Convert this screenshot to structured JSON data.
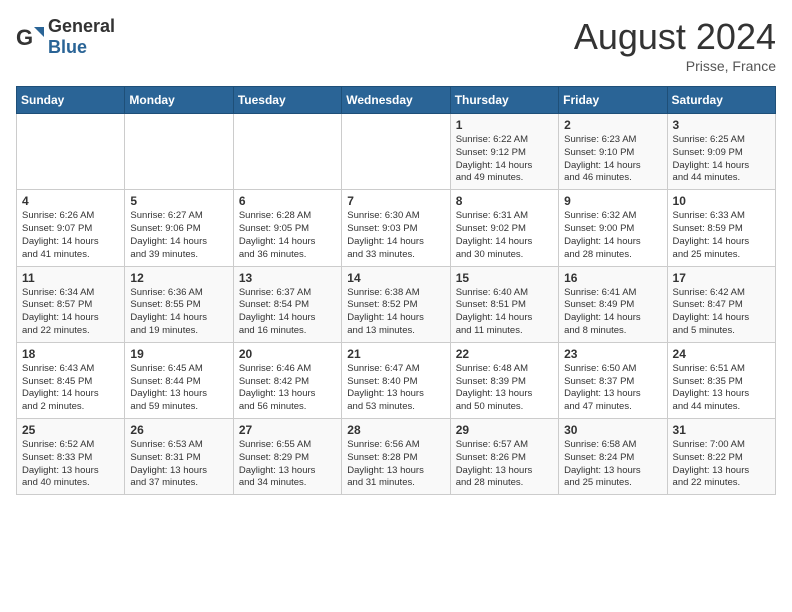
{
  "header": {
    "logo_general": "General",
    "logo_blue": "Blue",
    "month_year": "August 2024",
    "location": "Prisse, France"
  },
  "weekdays": [
    "Sunday",
    "Monday",
    "Tuesday",
    "Wednesday",
    "Thursday",
    "Friday",
    "Saturday"
  ],
  "weeks": [
    [
      {
        "day": "",
        "info": ""
      },
      {
        "day": "",
        "info": ""
      },
      {
        "day": "",
        "info": ""
      },
      {
        "day": "",
        "info": ""
      },
      {
        "day": "1",
        "info": "Sunrise: 6:22 AM\nSunset: 9:12 PM\nDaylight: 14 hours\nand 49 minutes."
      },
      {
        "day": "2",
        "info": "Sunrise: 6:23 AM\nSunset: 9:10 PM\nDaylight: 14 hours\nand 46 minutes."
      },
      {
        "day": "3",
        "info": "Sunrise: 6:25 AM\nSunset: 9:09 PM\nDaylight: 14 hours\nand 44 minutes."
      }
    ],
    [
      {
        "day": "4",
        "info": "Sunrise: 6:26 AM\nSunset: 9:07 PM\nDaylight: 14 hours\nand 41 minutes."
      },
      {
        "day": "5",
        "info": "Sunrise: 6:27 AM\nSunset: 9:06 PM\nDaylight: 14 hours\nand 39 minutes."
      },
      {
        "day": "6",
        "info": "Sunrise: 6:28 AM\nSunset: 9:05 PM\nDaylight: 14 hours\nand 36 minutes."
      },
      {
        "day": "7",
        "info": "Sunrise: 6:30 AM\nSunset: 9:03 PM\nDaylight: 14 hours\nand 33 minutes."
      },
      {
        "day": "8",
        "info": "Sunrise: 6:31 AM\nSunset: 9:02 PM\nDaylight: 14 hours\nand 30 minutes."
      },
      {
        "day": "9",
        "info": "Sunrise: 6:32 AM\nSunset: 9:00 PM\nDaylight: 14 hours\nand 28 minutes."
      },
      {
        "day": "10",
        "info": "Sunrise: 6:33 AM\nSunset: 8:59 PM\nDaylight: 14 hours\nand 25 minutes."
      }
    ],
    [
      {
        "day": "11",
        "info": "Sunrise: 6:34 AM\nSunset: 8:57 PM\nDaylight: 14 hours\nand 22 minutes."
      },
      {
        "day": "12",
        "info": "Sunrise: 6:36 AM\nSunset: 8:55 PM\nDaylight: 14 hours\nand 19 minutes."
      },
      {
        "day": "13",
        "info": "Sunrise: 6:37 AM\nSunset: 8:54 PM\nDaylight: 14 hours\nand 16 minutes."
      },
      {
        "day": "14",
        "info": "Sunrise: 6:38 AM\nSunset: 8:52 PM\nDaylight: 14 hours\nand 13 minutes."
      },
      {
        "day": "15",
        "info": "Sunrise: 6:40 AM\nSunset: 8:51 PM\nDaylight: 14 hours\nand 11 minutes."
      },
      {
        "day": "16",
        "info": "Sunrise: 6:41 AM\nSunset: 8:49 PM\nDaylight: 14 hours\nand 8 minutes."
      },
      {
        "day": "17",
        "info": "Sunrise: 6:42 AM\nSunset: 8:47 PM\nDaylight: 14 hours\nand 5 minutes."
      }
    ],
    [
      {
        "day": "18",
        "info": "Sunrise: 6:43 AM\nSunset: 8:45 PM\nDaylight: 14 hours\nand 2 minutes."
      },
      {
        "day": "19",
        "info": "Sunrise: 6:45 AM\nSunset: 8:44 PM\nDaylight: 13 hours\nand 59 minutes."
      },
      {
        "day": "20",
        "info": "Sunrise: 6:46 AM\nSunset: 8:42 PM\nDaylight: 13 hours\nand 56 minutes."
      },
      {
        "day": "21",
        "info": "Sunrise: 6:47 AM\nSunset: 8:40 PM\nDaylight: 13 hours\nand 53 minutes."
      },
      {
        "day": "22",
        "info": "Sunrise: 6:48 AM\nSunset: 8:39 PM\nDaylight: 13 hours\nand 50 minutes."
      },
      {
        "day": "23",
        "info": "Sunrise: 6:50 AM\nSunset: 8:37 PM\nDaylight: 13 hours\nand 47 minutes."
      },
      {
        "day": "24",
        "info": "Sunrise: 6:51 AM\nSunset: 8:35 PM\nDaylight: 13 hours\nand 44 minutes."
      }
    ],
    [
      {
        "day": "25",
        "info": "Sunrise: 6:52 AM\nSunset: 8:33 PM\nDaylight: 13 hours\nand 40 minutes."
      },
      {
        "day": "26",
        "info": "Sunrise: 6:53 AM\nSunset: 8:31 PM\nDaylight: 13 hours\nand 37 minutes."
      },
      {
        "day": "27",
        "info": "Sunrise: 6:55 AM\nSunset: 8:29 PM\nDaylight: 13 hours\nand 34 minutes."
      },
      {
        "day": "28",
        "info": "Sunrise: 6:56 AM\nSunset: 8:28 PM\nDaylight: 13 hours\nand 31 minutes."
      },
      {
        "day": "29",
        "info": "Sunrise: 6:57 AM\nSunset: 8:26 PM\nDaylight: 13 hours\nand 28 minutes."
      },
      {
        "day": "30",
        "info": "Sunrise: 6:58 AM\nSunset: 8:24 PM\nDaylight: 13 hours\nand 25 minutes."
      },
      {
        "day": "31",
        "info": "Sunrise: 7:00 AM\nSunset: 8:22 PM\nDaylight: 13 hours\nand 22 minutes."
      }
    ]
  ]
}
